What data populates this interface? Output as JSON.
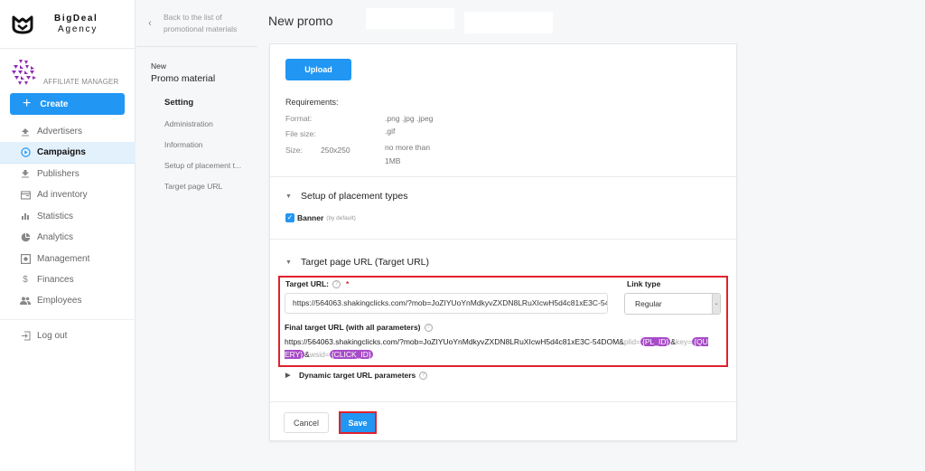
{
  "brand": {
    "line1": "BigDeal",
    "line2": "Agency",
    "logo_icon": "bigdeal-logo-icon"
  },
  "role": {
    "label": "AFFILIATE MANAGER",
    "avatar_icon": "purple-geometric-avatar-icon"
  },
  "create_button": {
    "label": "Create",
    "icon": "plus-icon"
  },
  "colors": {
    "accent": "#2196f3",
    "highlight": "#e0212e",
    "param_tag": "#a74bc7",
    "active_nav_bg": "#e3f1fd"
  },
  "nav": {
    "items": [
      {
        "label": "Advertisers",
        "icon": "upload-arrow-icon",
        "active": false
      },
      {
        "label": "Campaigns",
        "icon": "play-circle-icon",
        "active": true
      },
      {
        "label": "Publishers",
        "icon": "download-arrow-icon",
        "active": false
      },
      {
        "label": "Ad inventory",
        "icon": "window-icon",
        "active": false
      },
      {
        "label": "Statistics",
        "icon": "bar-chart-icon",
        "active": false
      },
      {
        "label": "Analytics",
        "icon": "pie-chart-icon",
        "active": false
      },
      {
        "label": "Management",
        "icon": "settings-box-icon",
        "active": false
      },
      {
        "label": "Finances",
        "icon": "dollar-icon",
        "active": false
      },
      {
        "label": "Employees",
        "icon": "people-icon",
        "active": false
      }
    ],
    "logout": {
      "label": "Log out",
      "icon": "logout-icon"
    }
  },
  "subnav": {
    "back_label": "Back to the list of promotional materials",
    "title_small": "New",
    "title": "Promo material",
    "items": [
      {
        "label": "Setting",
        "active": true
      },
      {
        "label": "Administration",
        "active": false
      },
      {
        "label": "Information",
        "active": false
      },
      {
        "label": "Setup of placement t...",
        "active": false
      },
      {
        "label": "Target page URL",
        "active": false
      }
    ]
  },
  "page": {
    "title": "New promo"
  },
  "upload": {
    "button_label": "Upload",
    "requirements_title": "Requirements:",
    "format_label": "Format:",
    "format_value_1": ".png .jpg .jpeg",
    "format_value_2": ".gif",
    "filesize_label": "File size:",
    "size_label": "Size:",
    "size_value": "250x250",
    "filesize_value_1": "no more than",
    "filesize_value_2": "1MB"
  },
  "placement": {
    "section_title": "Setup of placement types",
    "banner_label": "Banner",
    "banner_note": "(by default)",
    "banner_checked": true
  },
  "target": {
    "section_title": "Target page URL (Target URL)",
    "url_label": "Target URL:",
    "url_value": "https://564063.shakingclicks.com/?mob=JoZIYUoYnMdkyvZXDN8LRuXIcwH5d4c81xE3C-54DOM",
    "link_type_label": "Link type",
    "link_type_value": "Regular",
    "final_label": "Final target URL (with all parameters)",
    "final_base": "https://564063.shakingclicks.com/?mob=JoZIYUoYnMdkyvZXDN8LRuXIcwH5d4c81xE3C-54DOM&",
    "final_params": [
      {
        "key": "plid=",
        "tag": "{PL_ID}"
      },
      {
        "key": "key=",
        "tag": "{QUERY}"
      },
      {
        "key": "wsid=",
        "tag": "{CLICK_ID}"
      }
    ],
    "dynamic_label": "Dynamic target URL parameters"
  },
  "footer": {
    "cancel_label": "Cancel",
    "save_label": "Save"
  }
}
